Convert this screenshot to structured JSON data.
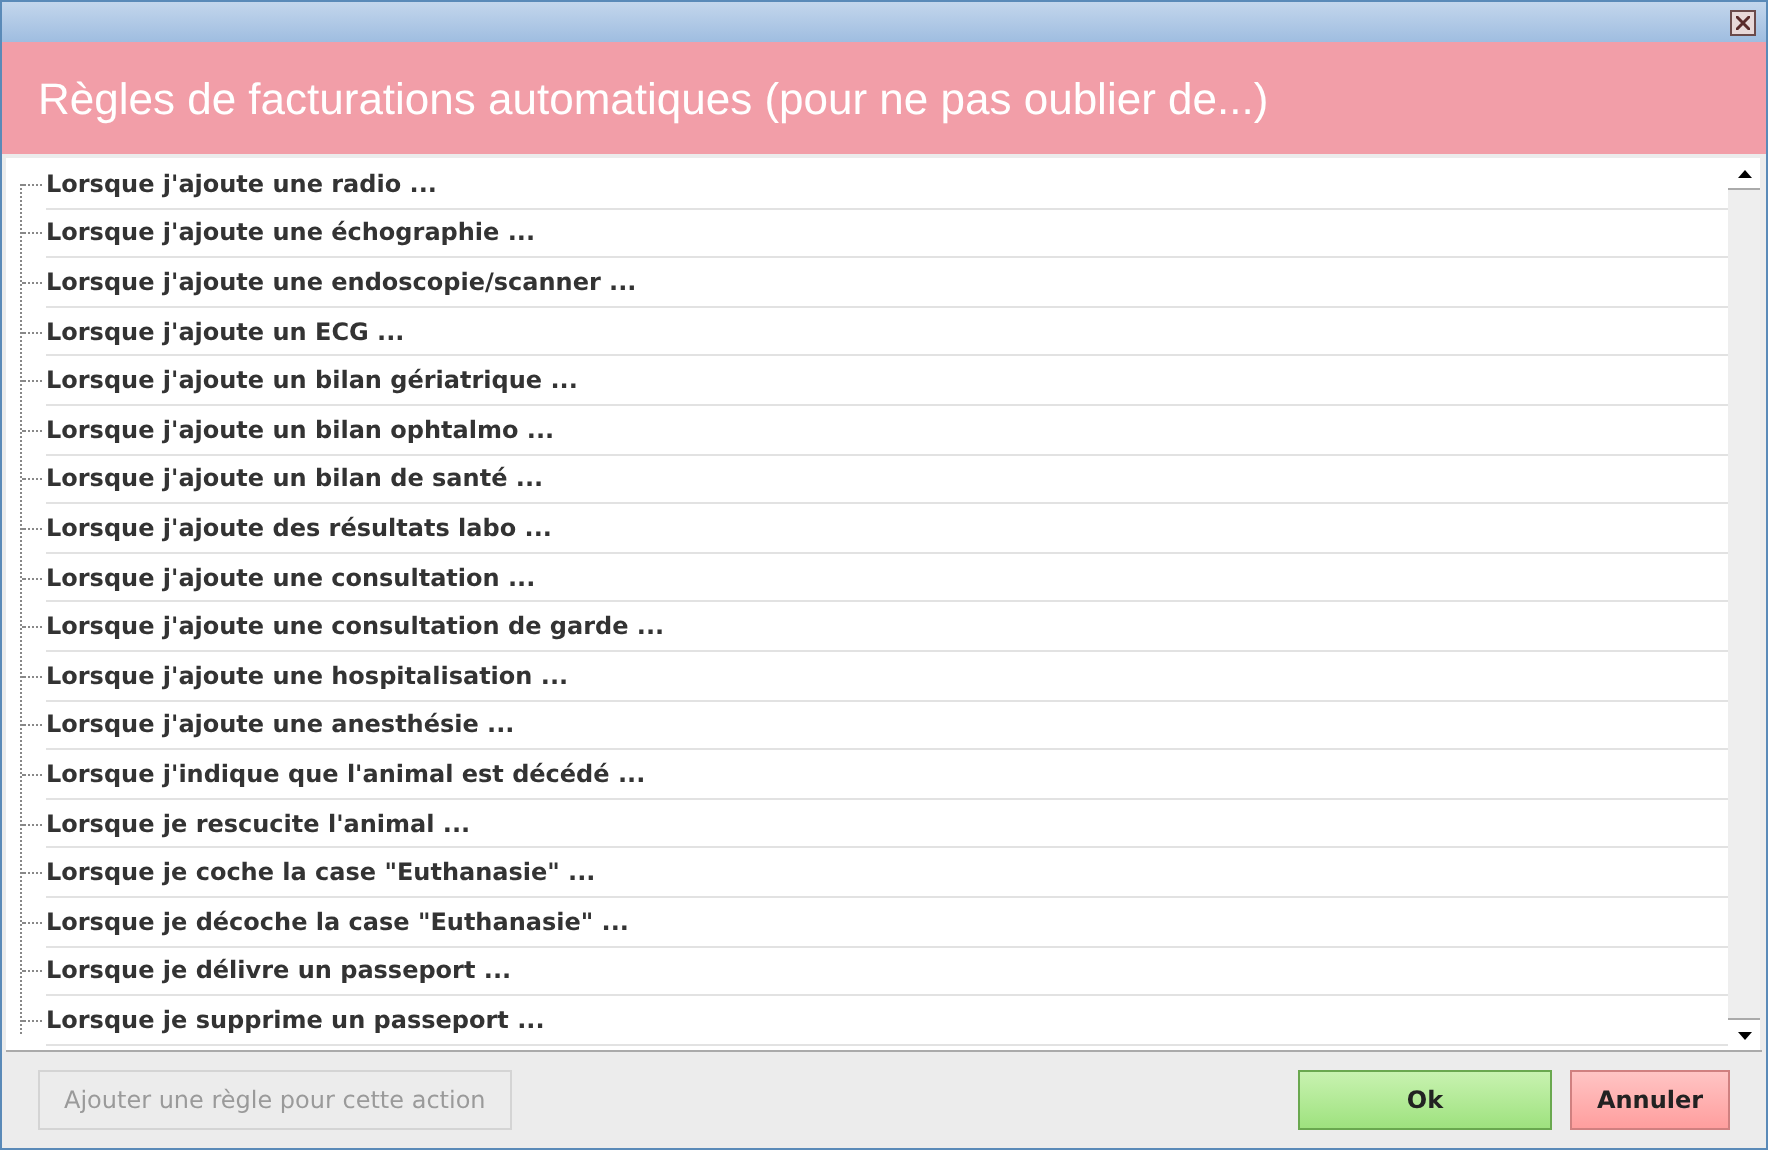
{
  "header": {
    "title": "Règles de facturations automatiques (pour ne pas oublier de...)"
  },
  "rules": [
    {
      "label": "Lorsque j'ajoute une radio ..."
    },
    {
      "label": "Lorsque j'ajoute une échographie ..."
    },
    {
      "label": "Lorsque j'ajoute une endoscopie/scanner ..."
    },
    {
      "label": "Lorsque j'ajoute un ECG ..."
    },
    {
      "label": "Lorsque j'ajoute un bilan gériatrique ..."
    },
    {
      "label": "Lorsque j'ajoute un bilan ophtalmo ..."
    },
    {
      "label": "Lorsque j'ajoute un bilan de santé ..."
    },
    {
      "label": "Lorsque j'ajoute des résultats labo ..."
    },
    {
      "label": "Lorsque j'ajoute une consultation ..."
    },
    {
      "label": "Lorsque j'ajoute une consultation de garde ..."
    },
    {
      "label": "Lorsque j'ajoute une hospitalisation ..."
    },
    {
      "label": "Lorsque j'ajoute une anesthésie ..."
    },
    {
      "label": "Lorsque j'indique que l'animal est décédé ..."
    },
    {
      "label": "Lorsque je rescucite l'animal ..."
    },
    {
      "label": "Lorsque je coche la case \"Euthanasie\" ..."
    },
    {
      "label": "Lorsque je décoche la case \"Euthanasie\" ..."
    },
    {
      "label": "Lorsque je délivre un passeport ..."
    },
    {
      "label": "Lorsque je supprime un passeport ..."
    }
  ],
  "add_button": {
    "label": "Ajouter une règle pour cette action",
    "disabled": true
  },
  "ok_button": {
    "label": "Ok"
  },
  "cancel_button": {
    "label": "Annuler"
  }
}
